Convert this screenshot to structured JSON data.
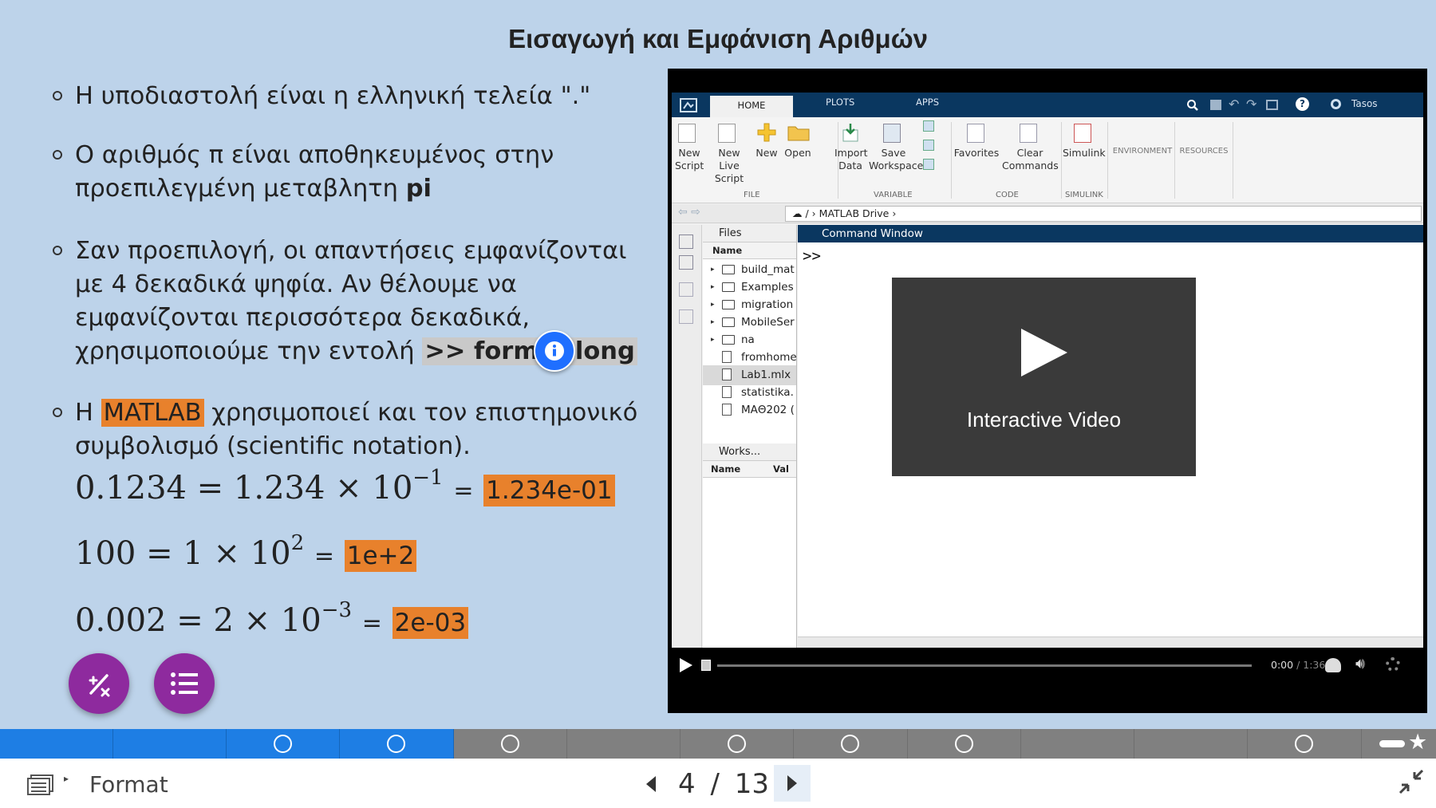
{
  "slide": {
    "title": "Εισαγωγή και Εμφάνιση Αριθμών",
    "bullet1": "Η υποδιαστολή είναι η ελληνική τελεία \".\"",
    "bullet2_text": "Ο αριθμός π είναι αποθηκευμένος στην προεπιλεγμένη μεταβλητη",
    "bullet2_var": "pi",
    "bullet3_text": "Σαν προεπιλογή, οι απαντήσεις  εμφανίζονται με 4 δεκαδικά ψηφία. Αν θέλουμε να εμφανίζονται περισσότερα δεκαδικά, χρησιμοποιούμε την εντολή",
    "bullet3_cmd": ">> format long",
    "bullet4_pre": "Η",
    "bullet4_matlab": "MATLAB",
    "bullet4_post": "χρησιμοποιεί  και τον επιστημονικό συμβολισμό (scientific notation).",
    "eq1_lhs": "0.1234 = 1.234 × 10",
    "eq1_exp": "−1",
    "eq1_res": "1.234e-01",
    "eq2_lhs": "100 = 1 × 10",
    "eq2_exp": "2",
    "eq2_res": "1e+2",
    "eq3_lhs": "0.002 = 2 × 10",
    "eq3_exp": "−3",
    "eq3_res": "2e-03",
    "equals": "="
  },
  "matlab": {
    "tabs": [
      "HOME",
      "PLOTS",
      "APPS"
    ],
    "user": "Tasos",
    "ribbon": {
      "new_script": "New\nScript",
      "new_live_script": "New\nLive Script",
      "new": "New",
      "open": "Open",
      "import_data": "Import\nData",
      "save_workspace": "Save\nWorkspace",
      "favorites": "Favorites",
      "clear_commands": "Clear\nCommands",
      "simulink": "Simulink",
      "environment": "ENVIRONMENT",
      "resources": "RESOURCES",
      "groups": [
        "FILE",
        "VARIABLE",
        "CODE",
        "SIMULINK"
      ]
    },
    "address": [
      "/",
      "MATLAB Drive"
    ],
    "files_title": "Files",
    "files_col": "Name",
    "files": [
      {
        "name": "build_mat",
        "type": "folder"
      },
      {
        "name": "Examples",
        "type": "folder"
      },
      {
        "name": "migration",
        "type": "folder"
      },
      {
        "name": "MobileSer",
        "type": "folder"
      },
      {
        "name": "na",
        "type": "folder"
      },
      {
        "name": "fromhome",
        "type": "file"
      },
      {
        "name": "Lab1.mlx",
        "type": "file",
        "selected": true
      },
      {
        "name": "statistika.",
        "type": "file"
      },
      {
        "name": "ΜΑΘ202 (",
        "type": "file"
      }
    ],
    "workspace_title": "Works...",
    "workspace_cols": [
      "Name",
      "Val"
    ],
    "command_window_title": "Command Window",
    "prompt": ">>"
  },
  "video": {
    "overlay_label": "Interactive Video",
    "time_current": "0:00",
    "time_total": "1:36"
  },
  "footer": {
    "title": "Format",
    "current_page": "4",
    "separator": "/",
    "total_pages": "13"
  },
  "colors": {
    "slide_bg": "#bdd3ea",
    "highlight_orange": "#e8812c",
    "progress_done": "#1e7ee4",
    "fab_purple": "#8e2a9e",
    "info_blue": "#1f6fff"
  }
}
